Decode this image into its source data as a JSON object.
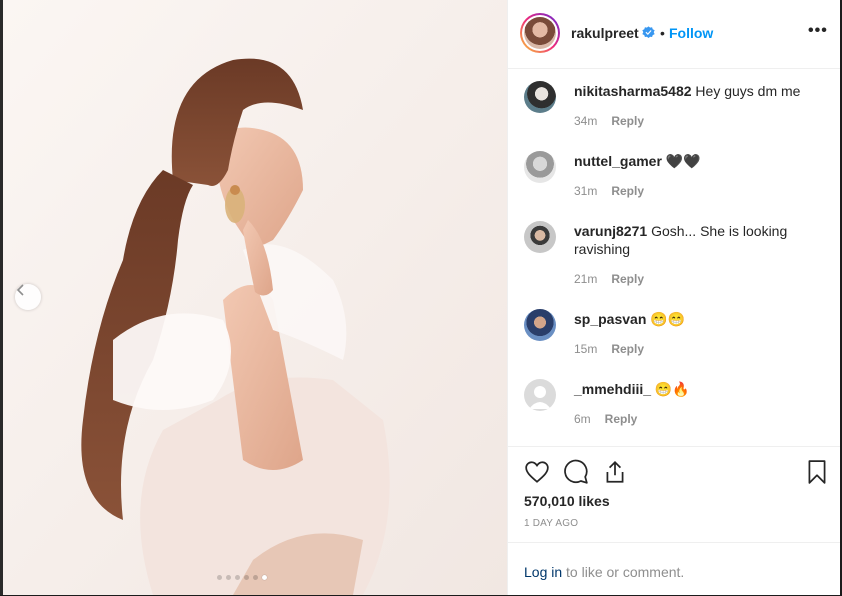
{
  "post": {
    "username": "rakulpreet",
    "separator": "•",
    "follow_label": "Follow",
    "more_label": "•••"
  },
  "carousel": {
    "dot_count": 6,
    "active_index": 5
  },
  "comments": [
    {
      "user": "nikitasharma5482",
      "text": "Hey guys dm me",
      "time": "34m",
      "reply": "Reply"
    },
    {
      "user": "nuttel_gamer",
      "text": "🖤🖤",
      "time": "31m",
      "reply": "Reply"
    },
    {
      "user": "varunj8271",
      "text": "Gosh... She is looking ravishing",
      "time": "21m",
      "reply": "Reply"
    },
    {
      "user": "sp_pasvan",
      "text": "😁😁",
      "time": "15m",
      "reply": "Reply"
    },
    {
      "user": "_mmehdiii_",
      "text": "😁🔥",
      "time": "6m",
      "reply": "Reply"
    }
  ],
  "stats": {
    "likes": "570,010 likes",
    "posted": "1 DAY AGO"
  },
  "login": {
    "link": "Log in",
    "rest": " to like or comment."
  },
  "colors": {
    "link_blue": "#0095f6",
    "muted": "#8e8e8e",
    "dark_link": "#00376b"
  },
  "icons": [
    "verified-icon",
    "more-options-icon",
    "heart-icon",
    "comment-icon",
    "share-icon",
    "bookmark-icon",
    "chevron-left-icon"
  ]
}
